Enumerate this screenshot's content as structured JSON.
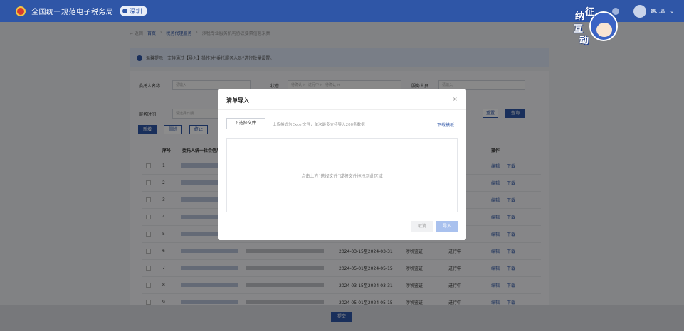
{
  "header": {
    "title": "全国统一规范电子税务局",
    "city": "深圳",
    "user": "韩…四"
  },
  "mascot": {
    "chars": [
      "纳",
      "征",
      "互",
      "动"
    ]
  },
  "breadcrumb": {
    "back": "← 返回",
    "home": "首页",
    "parent": "税务代理服务",
    "current": "涉税专业服务机构协议要素信息采集"
  },
  "notice": "温馨提示：支持通过【导入】操作对“委托服务人员”进行批量设置。",
  "filters": {
    "client_label": "委托人名称",
    "client_placeholder": "请输入",
    "status_label": "状态",
    "status_tags": [
      "待确认 ×",
      "进行中 ×",
      "待确认 ×"
    ],
    "staff_label": "服务人员",
    "staff_placeholder": "请输入",
    "time_label": "服务时间",
    "time_placeholder": "请选择日期",
    "reset": "重置",
    "query": "查询"
  },
  "toolbar": {
    "add": "新增",
    "delete": "删除",
    "terminate": "终止"
  },
  "table": {
    "headers": [
      "序号",
      "委托人统一社会信用代码",
      "操作"
    ],
    "rows": [
      {
        "no": "1",
        "date": "",
        "type": "",
        "status": "",
        "edit": "编辑",
        "download": "下载"
      },
      {
        "no": "2",
        "date": "",
        "type": "",
        "status": "",
        "edit": "编辑",
        "download": "下载"
      },
      {
        "no": "3",
        "date": "",
        "type": "",
        "status": "",
        "edit": "编辑",
        "download": "下载"
      },
      {
        "no": "4",
        "date": "",
        "type": "",
        "status": "",
        "edit": "编辑",
        "download": "下载"
      },
      {
        "no": "5",
        "date": "",
        "type": "",
        "status": "",
        "edit": "编辑",
        "download": "下载"
      },
      {
        "no": "6",
        "date": "2024-03-15至2024-03-31",
        "type": "涉税鉴证",
        "status": "进行中",
        "edit": "编辑",
        "download": "下载"
      },
      {
        "no": "7",
        "date": "2024-05-01至2024-05-15",
        "type": "涉税鉴证",
        "status": "进行中",
        "edit": "编辑",
        "download": "下载"
      },
      {
        "no": "8",
        "date": "2024-03-15至2024-03-31",
        "type": "涉税鉴证",
        "status": "进行中",
        "edit": "编辑",
        "download": "下载"
      },
      {
        "no": "9",
        "date": "2024-05-01至2024-05-15",
        "type": "涉税鉴证",
        "status": "进行中",
        "edit": "编辑",
        "download": "下载"
      }
    ]
  },
  "footer": {
    "submit": "提交"
  },
  "modal": {
    "title": "清单导入",
    "close": "×",
    "choose_file": "选择文件",
    "hint": "上传格式为Excel文件，单次最多支持导入200条数据",
    "download_template": "下载模板",
    "drop_text": "点击上方“选择文件”或将文件拖拽到此区域",
    "cancel": "取消",
    "import": "导入"
  },
  "colors": {
    "brand": "#2f56a7",
    "overlay": "rgba(0,0,0,0.45)"
  }
}
